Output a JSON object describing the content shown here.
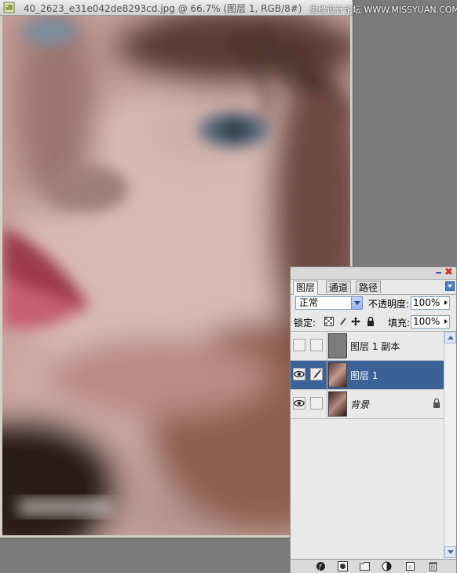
{
  "document": {
    "title": "40_2623_e31e042de8293cd.jpg @ 66.7% (图层 1, RGB/8#)",
    "watermark": "思缘设计论坛 WWW.MISSYUAN.COM"
  },
  "layers_panel": {
    "tabs": [
      {
        "label": "图层",
        "active": true
      },
      {
        "label": "通道",
        "active": false
      },
      {
        "label": "路径",
        "active": false
      }
    ],
    "blend_mode": "正常",
    "opacity_label": "不透明度:",
    "opacity_value": "100%",
    "lock_label": "锁定:",
    "fill_label": "填充:",
    "fill_value": "100%",
    "layers": [
      {
        "name": "图层 1 副本",
        "visible": false,
        "selected": false,
        "locked": false
      },
      {
        "name": "图层 1",
        "visible": true,
        "selected": true,
        "locked": false
      },
      {
        "name": "背景",
        "visible": true,
        "selected": false,
        "locked": true
      }
    ]
  },
  "colors": {
    "workspace": "#7b7b7b",
    "selection": "#3a6296",
    "close_button": "#d7261a"
  }
}
